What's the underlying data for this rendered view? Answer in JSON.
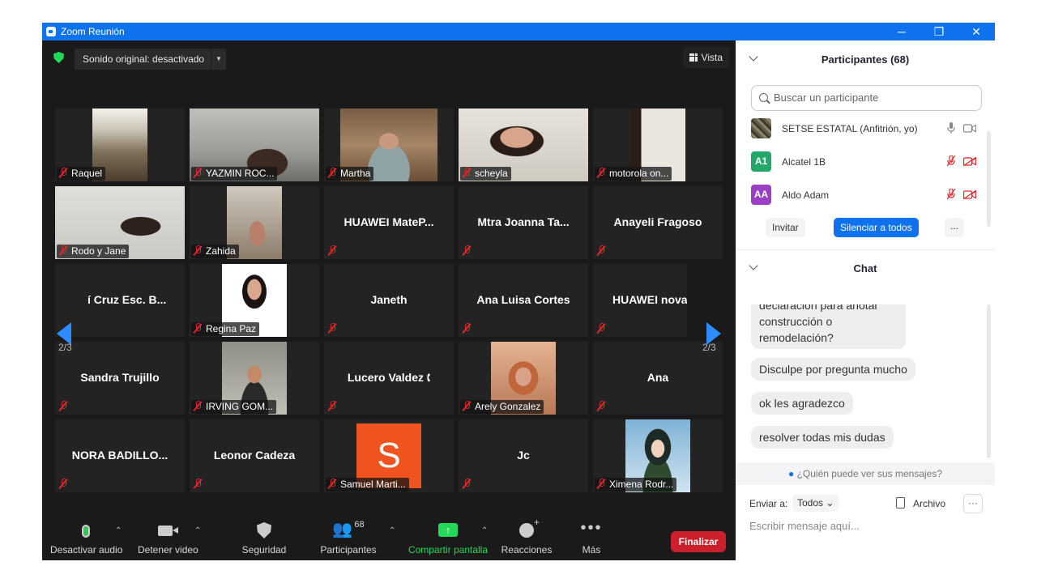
{
  "window": {
    "title": "Zoom Reunión",
    "minimize": "─",
    "restore": "❐",
    "close": "✕"
  },
  "topbar": {
    "sound_label": "Sonido original: desactivado",
    "sound_caret": "▼",
    "view_label": "Vista"
  },
  "grid_nav": {
    "page_left": "2/3",
    "page_right": "2/3"
  },
  "tiles": [
    {
      "label": "Raquel",
      "pname": ""
    },
    {
      "label": "YAZMIN ROC...",
      "pname": ""
    },
    {
      "label": "Martha",
      "pname": ""
    },
    {
      "label": "scheyla",
      "pname": ""
    },
    {
      "label": "motorola on...",
      "pname": ""
    },
    {
      "label": "Rodo y Jane",
      "pname": ""
    },
    {
      "label": "Zahida",
      "pname": ""
    },
    {
      "label": "",
      "pname": "HUAWEI MateP..."
    },
    {
      "label": "",
      "pname": "Mtra Joanna Ta..."
    },
    {
      "label": "",
      "pname": "Anayeli Fragoso"
    },
    {
      "label": "",
      "pname": "í Cruz Esc. B..."
    },
    {
      "label": "Regina Paz",
      "pname": ""
    },
    {
      "label": "",
      "pname": "Janeth"
    },
    {
      "label": "",
      "pname": "Ana Luisa Cortes"
    },
    {
      "label": "",
      "pname": "HUAWEI nova"
    },
    {
      "label": "",
      "pname": "Sandra Trujillo"
    },
    {
      "label": "IRVING GOM...",
      "pname": ""
    },
    {
      "label": "",
      "pname": "Lucero  Valdez 🕻"
    },
    {
      "label": "Arely Gonzalez",
      "pname": ""
    },
    {
      "label": "",
      "pname": "Ana"
    },
    {
      "label": "",
      "pname": "NORA BADILLO..."
    },
    {
      "label": "",
      "pname": "Leonor Cadeza"
    },
    {
      "label": "Samuel Marti...",
      "pname": "",
      "avatar": "S"
    },
    {
      "label": "",
      "pname": "Jc"
    },
    {
      "label": "Ximena Rodr...",
      "pname": ""
    }
  ],
  "toolbar": {
    "audio": "Desactivar audio",
    "video": "Detener video",
    "security": "Seguridad",
    "participants": "Participantes",
    "participants_count": "68",
    "share": "Compartir pantalla",
    "reactions": "Reacciones",
    "more": "Más",
    "end": "Finalizar",
    "caret": "⌃",
    "more_dots": "•••",
    "share_arrow": "↑"
  },
  "participants_panel": {
    "title": "Participantes (68)",
    "search_placeholder": "Buscar un participante",
    "list": [
      {
        "name": "SETSE ESTATAL (Anfitrión, yo)",
        "initials": "",
        "color": "#6b6b55"
      },
      {
        "name": "Alcatel 1B",
        "initials": "A1",
        "color": "#23a86a"
      },
      {
        "name": "Aldo Adam",
        "initials": "AA",
        "color": "#9b3fc4"
      }
    ],
    "invite": "Invitar",
    "mute_all": "Silenciar a todos",
    "more": "..."
  },
  "chat_panel": {
    "title": "Chat",
    "messages": [
      "declaración para anotar construcción o remodelación?",
      "Disculpe por pregunta mucho",
      "ok les agradezco",
      "resolver todas mis dudas"
    ],
    "who_can_see": "¿Quién puede ver sus mensajes?",
    "send_to_label": "Enviar a:",
    "send_to_value": "Todos",
    "file_label": "Archivo",
    "dots": "···",
    "compose_placeholder": "Escribir mensaje aquí..."
  },
  "colors": {
    "accent": "#0e72ed",
    "end_red": "#cc1f2c",
    "mute_red": "#e02828",
    "share_green": "#23d959"
  }
}
